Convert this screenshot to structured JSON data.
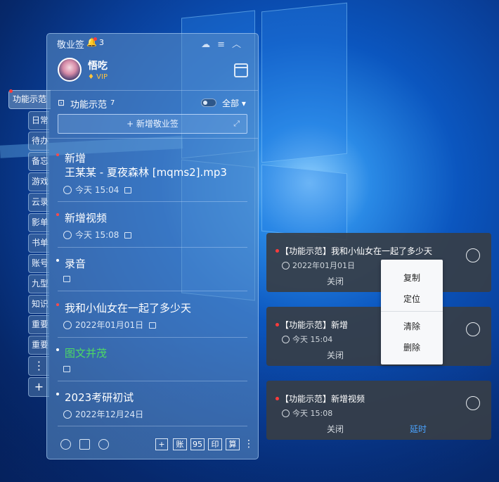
{
  "app": {
    "title": "敬业签",
    "notif_count": "3"
  },
  "user": {
    "name": "悟吃",
    "badge": "VIP"
  },
  "side_tabs": {
    "active": "功能示范",
    "items": [
      "日常",
      "待办",
      "备忘",
      "游戏",
      "云录",
      "影单",
      "书单",
      "账号",
      "九型",
      "知识",
      "重要",
      "重要"
    ]
  },
  "category": {
    "label": "功能示范",
    "count": "7",
    "filter": "全部 ▾"
  },
  "add_button": {
    "label": "+ 新增敬业签"
  },
  "notes": [
    {
      "title": "新增",
      "body": "王某某 - 夏夜森林 [mqms2].mp3",
      "time": "今天 15:04",
      "red": true
    },
    {
      "title": "新增视频",
      "body": "",
      "time": "今天 15:08",
      "red": true
    },
    {
      "title": "录音",
      "body": "",
      "time": "",
      "red": false
    },
    {
      "title": "我和小仙女在一起了多少天",
      "body": "",
      "time": "2022年01月01日",
      "red": true
    },
    {
      "title": "图文并茂",
      "body": "",
      "time": "",
      "red": false,
      "color": "#4cd964"
    },
    {
      "title": "2023考研初试",
      "body": "",
      "time": "2022年12月24日",
      "red": false
    }
  ],
  "bottom_bar": {
    "boxes": [
      "+",
      "账",
      "95",
      "印",
      "算"
    ],
    "more": "⋮"
  },
  "cards": [
    {
      "title": "【功能示范】我和小仙女在一起了多少天",
      "time": "2022年01月01日",
      "close": "关闭",
      "delay": ""
    },
    {
      "title": "【功能示范】新增",
      "time": "今天  15:04",
      "close": "关闭",
      "delay": ""
    },
    {
      "title": "【功能示范】新增视频",
      "time": "今天  15:08",
      "close": "关闭",
      "delay": "延时"
    }
  ],
  "context_menu": {
    "items": [
      "复制",
      "定位",
      "清除",
      "删除"
    ]
  },
  "colors": {
    "accent": "#4aa3ff",
    "red": "#ff3b3b",
    "green": "#4cd964"
  }
}
